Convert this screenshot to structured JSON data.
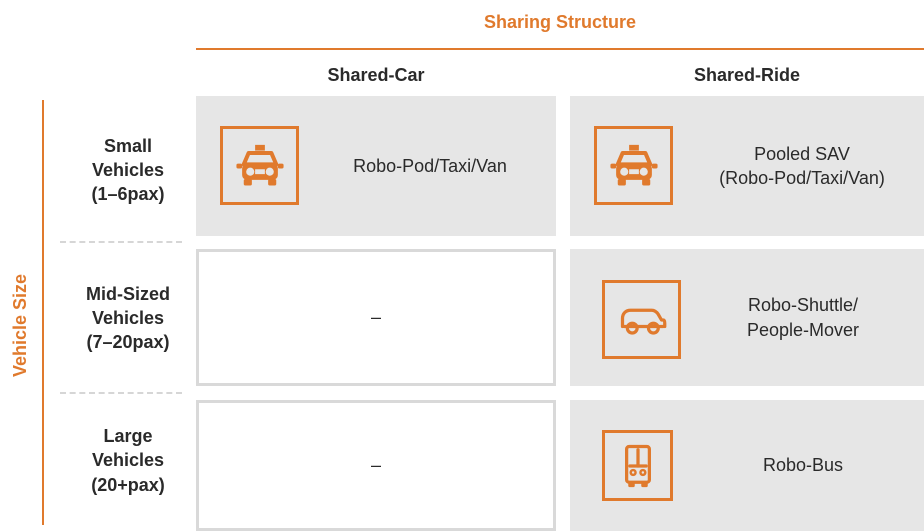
{
  "header": {
    "title": "Sharing Structure",
    "columns": [
      "Shared-Car",
      "Shared-Ride"
    ]
  },
  "rows_axis": {
    "title": "Vehicle Size"
  },
  "rows": [
    {
      "label_lines": [
        "Small",
        "Vehicles",
        "(1–6pax)"
      ],
      "shared_car": {
        "icon": "taxi-icon",
        "text": "Robo-Pod/Taxi/Van"
      },
      "shared_ride": {
        "icon": "taxi-icon",
        "text": "Pooled SAV\n(Robo-Pod/Taxi/Van)"
      }
    },
    {
      "label_lines": [
        "Mid-Sized",
        "Vehicles",
        "(7–20pax)"
      ],
      "shared_car": {
        "icon": "",
        "text": "–"
      },
      "shared_ride": {
        "icon": "shuttle-icon",
        "text": "Robo-Shuttle/\nPeople-Mover"
      }
    },
    {
      "label_lines": [
        "Large",
        "Vehicles",
        "(20+pax)"
      ],
      "shared_car": {
        "icon": "",
        "text": "–"
      },
      "shared_ride": {
        "icon": "bus-icon",
        "text": "Robo-Bus"
      }
    }
  ],
  "colors": {
    "accent": "#E07A2D",
    "cell_fill": "#E6E6E6",
    "cell_border": "#D9D9D9",
    "text": "#2A2A2A"
  }
}
